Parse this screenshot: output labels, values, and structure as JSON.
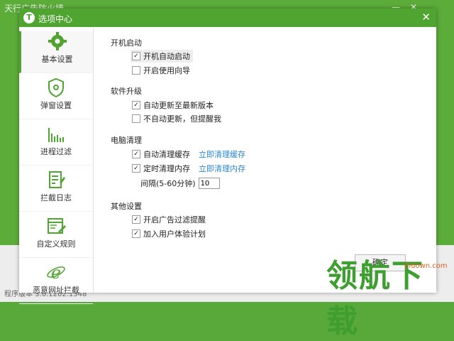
{
  "background": {
    "title": "天行广告防火墙",
    "controls": [
      "—",
      "✕"
    ],
    "version": "程序版本 3.0.1202.1348"
  },
  "dialog": {
    "logo_letter": "T",
    "title": "选项中心",
    "close": "✕",
    "accent_color": "#4fa530"
  },
  "sidebar": {
    "items": [
      {
        "label": "基本设置",
        "icon": "gear-icon"
      },
      {
        "label": "弹窗设置",
        "icon": "shield-icon"
      },
      {
        "label": "进程过滤",
        "icon": "bar-chart-icon"
      },
      {
        "label": "拦截日志",
        "icon": "log-icon"
      },
      {
        "label": "自定义规则",
        "icon": "rule-icon"
      },
      {
        "label": "恶意网址拦截",
        "icon": "ie-icon"
      }
    ]
  },
  "sections": {
    "startup": {
      "title": "开机启动",
      "auto_start": "开机自动启动",
      "wizard": "开启使用向导"
    },
    "upgrade": {
      "title": "软件升级",
      "auto_update": "自动更新至最新版本",
      "no_auto": "不自动更新，但提醒我"
    },
    "cleanup": {
      "title": "电脑清理",
      "auto_cache": "自动清理缓存",
      "cache_link": "立即清理缓存",
      "timed_mem": "定时清理内存",
      "mem_link": "立即清理内存",
      "interval_label": "间隔(5-60分钟)",
      "interval_value": "10"
    },
    "other": {
      "title": "其他设置",
      "ad_reminder": "开启广告过滤提醒",
      "ux_plan": "加入用户体验计划"
    }
  },
  "footer": {
    "ok": "确定"
  },
  "watermark": {
    "text": "领航下载",
    "sub": "lhdown.com"
  }
}
